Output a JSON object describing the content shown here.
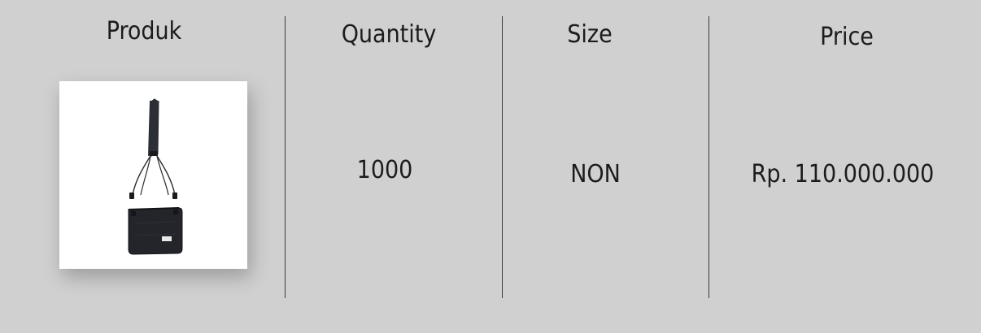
{
  "table": {
    "headers": {
      "product": "Produk",
      "quantity": "Quantity",
      "size": "Size",
      "price": "Price"
    },
    "row": {
      "product_image_icon": "crossbody-bag-icon",
      "quantity": "1000",
      "size": "NON",
      "price": "Rp. 110.000.000"
    }
  },
  "colors": {
    "background": "#d0d0d0",
    "divider": "#3a3a3a",
    "text": "#1c1c1c",
    "card": "#ffffff"
  }
}
